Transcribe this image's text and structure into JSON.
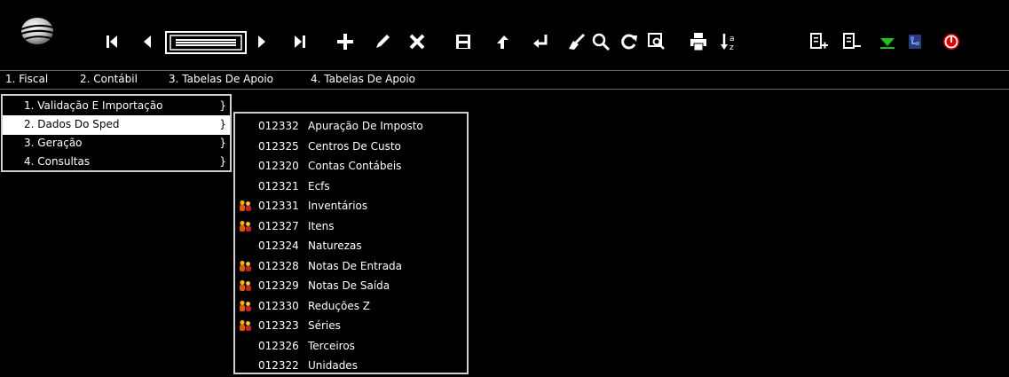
{
  "colors": {
    "background": "#000000",
    "menu_border": "#6a6a6a",
    "dropdown_border": "#d0d0d0",
    "selected_bg": "#ffffff",
    "green_arrow": "#1ec01e",
    "power_red": "#e00000"
  },
  "toolbar": {
    "icons": [
      "logo-icon",
      "first-record-icon",
      "prev-record-icon",
      "record-slider-icon",
      "next-record-icon",
      "last-record-icon",
      "add-icon",
      "edit-icon",
      "delete-icon",
      "save-icon",
      "copy-icon",
      "confirm-icon",
      "clean-icon",
      "search-icon",
      "refresh-icon",
      "preview-icon",
      "print-icon",
      "sort-icon",
      "insert-row-icon",
      "remove-row-icon",
      "expand-down-icon",
      "network-icon",
      "power-icon"
    ]
  },
  "menubar": {
    "items": [
      "1. Fiscal",
      "2. Contábil",
      "3. Tabelas De Apoio",
      "4. Tabelas De Apoio"
    ]
  },
  "submenu": {
    "items": [
      {
        "label": "1. Validação E Importação",
        "arrow": "}"
      },
      {
        "label": "2. Dados Do Sped",
        "arrow": "}"
      },
      {
        "label": "3. Geração",
        "arrow": "}"
      },
      {
        "label": "4. Consultas",
        "arrow": "}"
      }
    ],
    "selected_index": 1
  },
  "sped_menu": {
    "items": [
      {
        "code": "012332",
        "name": "Apuração De Imposto",
        "icon": ""
      },
      {
        "code": "012325",
        "name": "Centros De Custo",
        "icon": ""
      },
      {
        "code": "012320",
        "name": "Contas Contábeis",
        "icon": ""
      },
      {
        "code": "012321",
        "name": "Ecfs",
        "icon": ""
      },
      {
        "code": "012331",
        "name": "Inventários",
        "icon": "users-icon"
      },
      {
        "code": "012327",
        "name": "Itens",
        "icon": "users-icon"
      },
      {
        "code": "012324",
        "name": "Naturezas",
        "icon": ""
      },
      {
        "code": "012328",
        "name": "Notas De Entrada",
        "icon": "users-icon"
      },
      {
        "code": "012329",
        "name": "Notas De Saída",
        "icon": "users-icon"
      },
      {
        "code": "012330",
        "name": "Reduções Z",
        "icon": "users-icon"
      },
      {
        "code": "012323",
        "name": "Séries",
        "icon": "users-icon"
      },
      {
        "code": "012326",
        "name": "Terceiros",
        "icon": ""
      },
      {
        "code": "012322",
        "name": "Unidades",
        "icon": ""
      }
    ]
  }
}
